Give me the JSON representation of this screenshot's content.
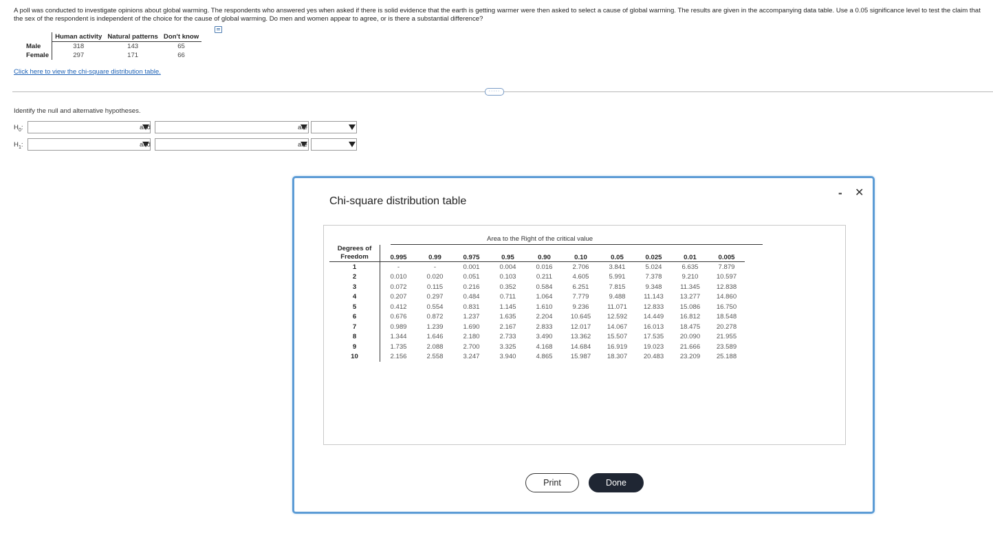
{
  "question": "A poll was conducted to investigate opinions about global warming. The respondents who answered yes when asked if there is solid evidence that the earth is getting warmer were then asked to select a cause of global warming. The results are given in the accompanying data table. Use a 0.05 significance level to test the claim that the sex of the respondent is independent of the choice for the cause of global warming. Do men and women appear to agree, or is there a substantial difference?",
  "data_table": {
    "headers": [
      "Human activity",
      "Natural patterns",
      "Don't know"
    ],
    "rows": [
      {
        "label": "Male",
        "values": [
          "318",
          "143",
          "65"
        ]
      },
      {
        "label": "Female",
        "values": [
          "297",
          "171",
          "66"
        ]
      }
    ]
  },
  "link_text": "Click here to view the chi-square distribution table.",
  "expander_text": "·····",
  "instruction": "Identify the null and alternative hypotheses.",
  "hypotheses": [
    {
      "label": "H",
      "sub": "0",
      "and": "and",
      "are": "are"
    },
    {
      "label": "H",
      "sub": "1",
      "and": "and",
      "are": "are"
    }
  ],
  "modal": {
    "title": "Chi-square distribution table",
    "minimize": "-",
    "close": "✕",
    "caption": "Area to the Right of the critical value",
    "df_header_line1": "Degrees of",
    "df_header_line2": "Freedom",
    "columns": [
      "0.995",
      "0.99",
      "0.975",
      "0.95",
      "0.90",
      "0.10",
      "0.05",
      "0.025",
      "0.01",
      "0.005"
    ],
    "rows": [
      [
        "1",
        "-",
        "-",
        "0.001",
        "0.004",
        "0.016",
        "2.706",
        "3.841",
        "5.024",
        "6.635",
        "7.879"
      ],
      [
        "2",
        "0.010",
        "0.020",
        "0.051",
        "0.103",
        "0.211",
        "4.605",
        "5.991",
        "7.378",
        "9.210",
        "10.597"
      ],
      [
        "3",
        "0.072",
        "0.115",
        "0.216",
        "0.352",
        "0.584",
        "6.251",
        "7.815",
        "9.348",
        "11.345",
        "12.838"
      ],
      [
        "4",
        "0.207",
        "0.297",
        "0.484",
        "0.711",
        "1.064",
        "7.779",
        "9.488",
        "11.143",
        "13.277",
        "14.860"
      ],
      [
        "5",
        "0.412",
        "0.554",
        "0.831",
        "1.145",
        "1.610",
        "9.236",
        "11.071",
        "12.833",
        "15.086",
        "16.750"
      ],
      [
        "6",
        "0.676",
        "0.872",
        "1.237",
        "1.635",
        "2.204",
        "10.645",
        "12.592",
        "14.449",
        "16.812",
        "18.548"
      ],
      [
        "7",
        "0.989",
        "1.239",
        "1.690",
        "2.167",
        "2.833",
        "12.017",
        "14.067",
        "16.013",
        "18.475",
        "20.278"
      ],
      [
        "8",
        "1.344",
        "1.646",
        "2.180",
        "2.733",
        "3.490",
        "13.362",
        "15.507",
        "17.535",
        "20.090",
        "21.955"
      ],
      [
        "9",
        "1.735",
        "2.088",
        "2.700",
        "3.325",
        "4.168",
        "14.684",
        "16.919",
        "19.023",
        "21.666",
        "23.589"
      ],
      [
        "10",
        "2.156",
        "2.558",
        "3.247",
        "3.940",
        "4.865",
        "15.987",
        "18.307",
        "20.483",
        "23.209",
        "25.188"
      ]
    ],
    "print_label": "Print",
    "done_label": "Done"
  }
}
